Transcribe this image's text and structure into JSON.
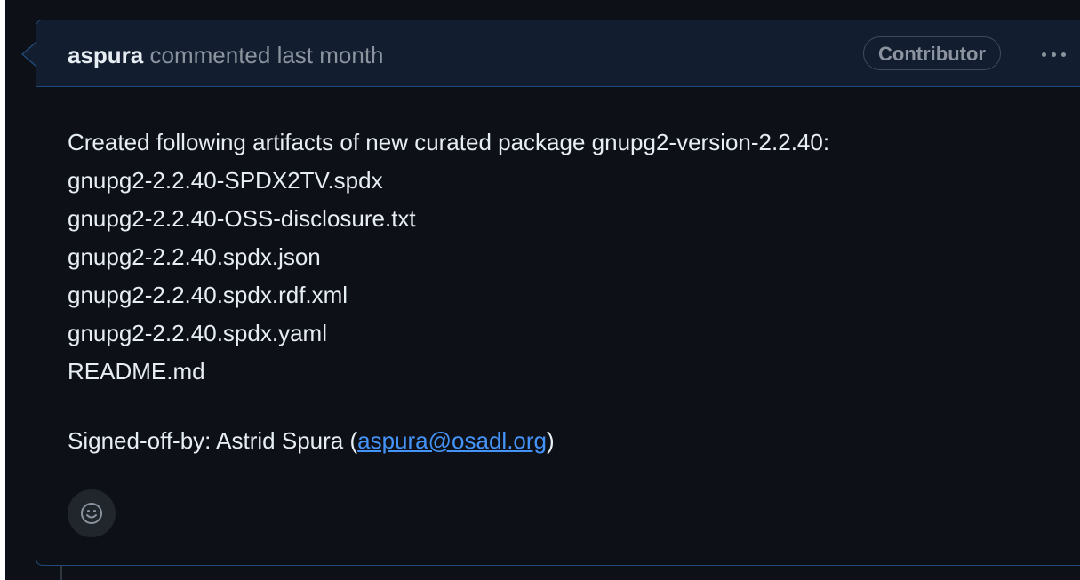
{
  "comment": {
    "author": "aspura",
    "action_text": "commented last month",
    "badge": "Contributor",
    "more_icon": "kebab-horizontal-icon",
    "body": {
      "intro": "Created following artifacts of new curated package gnupg2-version-2.2.40:",
      "files": [
        "gnupg2-2.2.40-SPDX2TV.spdx",
        "gnupg2-2.2.40-OSS-disclosure.txt",
        "gnupg2-2.2.40.spdx.json",
        "gnupg2-2.2.40.spdx.rdf.xml",
        "gnupg2-2.2.40.spdx.yaml",
        "README.md"
      ],
      "signoff_prefix": "Signed-off-by: Astrid Spura (",
      "signoff_email": "aspura@osadl.org",
      "signoff_suffix": ")"
    },
    "reaction_icon": "smiley-icon"
  },
  "colors": {
    "background": "#0d1117",
    "header_bg": "#121d2f",
    "border": "#1f4a7a",
    "text": "#e6edf3",
    "muted": "#8b949e",
    "link": "#4493f8"
  }
}
